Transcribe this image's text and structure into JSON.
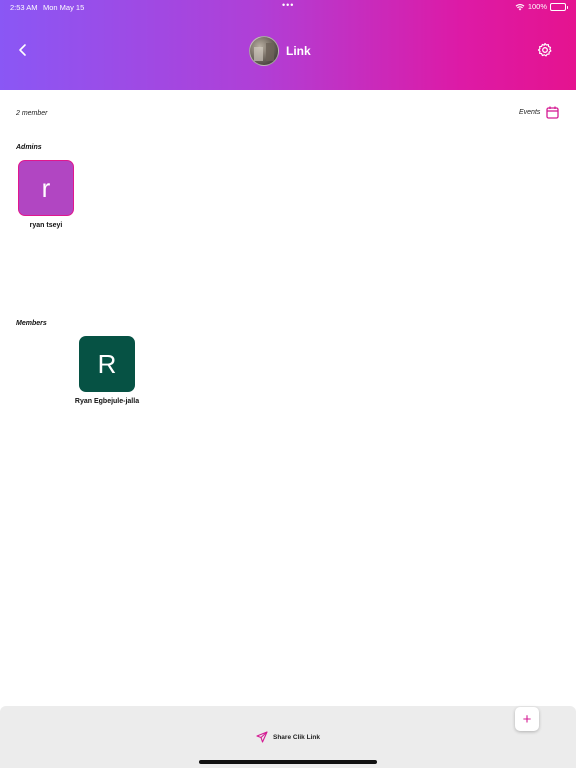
{
  "status_bar": {
    "time": "2:53 AM",
    "date": "Mon May 15",
    "battery": "100%",
    "dots": "•••"
  },
  "header": {
    "title": "Link",
    "back_icon": "chevron-left-icon",
    "settings_icon": "gear-icon",
    "gradient_start": "#8a57f5",
    "gradient_end": "#e5138f"
  },
  "summary": {
    "member_count": "2 member",
    "events_label": "Events",
    "events_icon": "calendar-icon"
  },
  "admins": {
    "label": "Admins",
    "items": [
      {
        "initial": "r",
        "name": "ryan tseyi",
        "color": "#b146c2"
      }
    ]
  },
  "members": {
    "label": "Members",
    "items": [
      {
        "initial": "R",
        "name": "Ryan Egbejule-jalla",
        "color": "#065244"
      }
    ]
  },
  "footer": {
    "share_label": "Share Clik Link",
    "share_icon": "paper-plane-icon",
    "add_icon": "plus-icon",
    "add_label": "+",
    "accent": "#d41a93"
  }
}
